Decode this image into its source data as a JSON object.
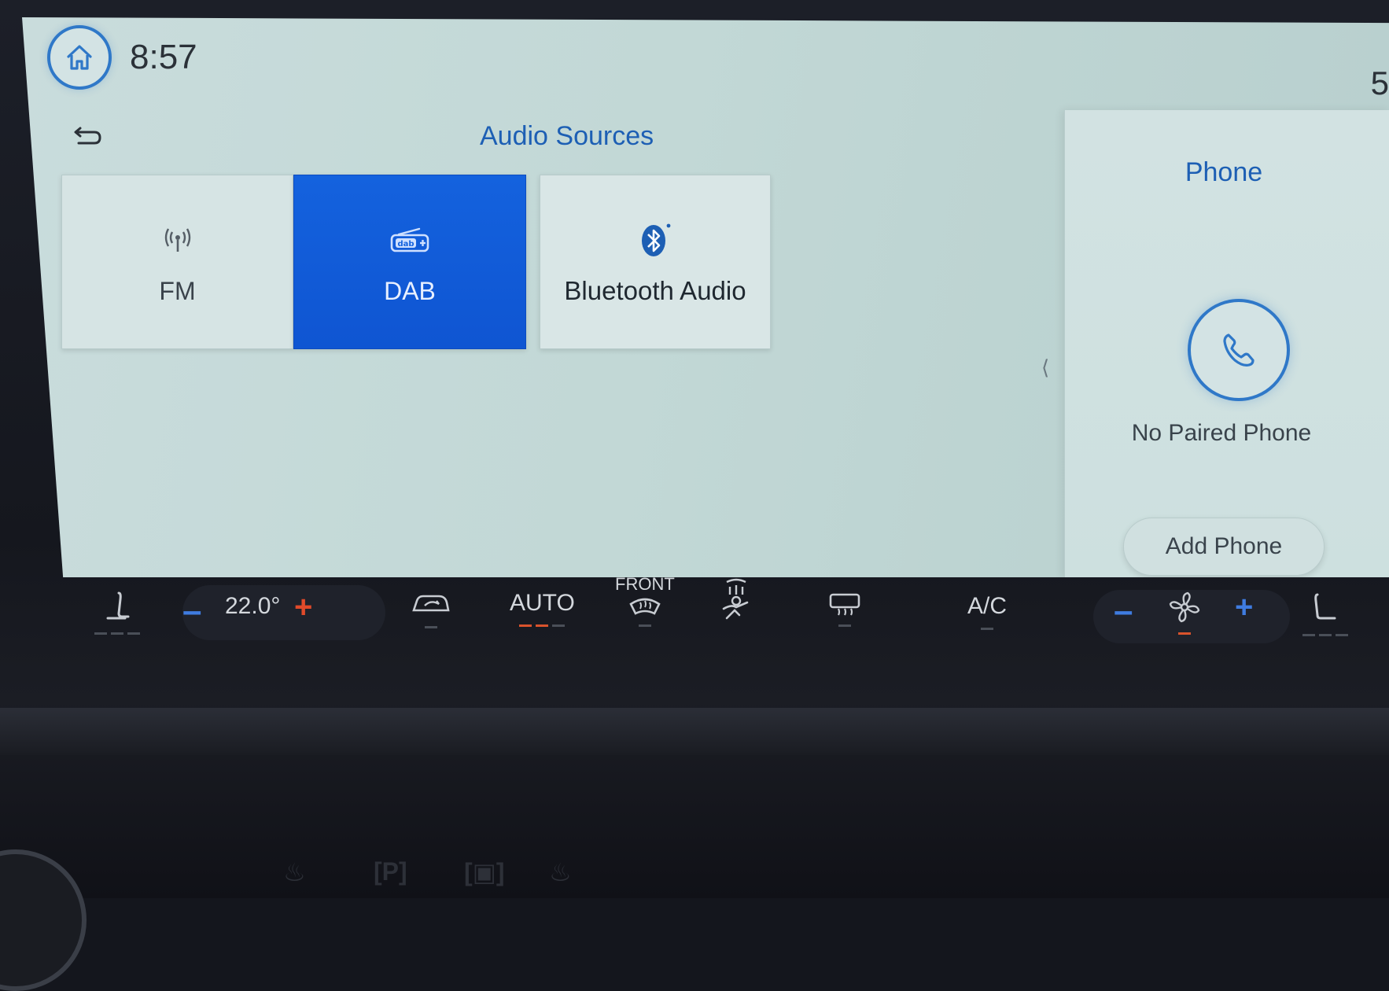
{
  "status": {
    "time": "8:57",
    "edge_number": "5"
  },
  "audio": {
    "title": "Audio Sources",
    "sources": [
      {
        "label": "FM",
        "icon": "radio-antenna-icon",
        "selected": false
      },
      {
        "label": "DAB",
        "icon": "dab-radio-icon",
        "selected": true
      },
      {
        "label": "Bluetooth Audio",
        "icon": "bluetooth-icon",
        "selected": false
      }
    ]
  },
  "phone": {
    "title": "Phone",
    "status": "No Paired Phone",
    "add_label": "Add Phone"
  },
  "climate": {
    "temperature": "22.0°",
    "auto_label": "AUTO",
    "front_label": "FRONT",
    "ac_label": "A/C"
  },
  "colors": {
    "accent": "#1d5fb4",
    "selected_tile": "#1462de",
    "screen_bg": "#c4d9d8",
    "indicator_on": "#d9532c"
  }
}
